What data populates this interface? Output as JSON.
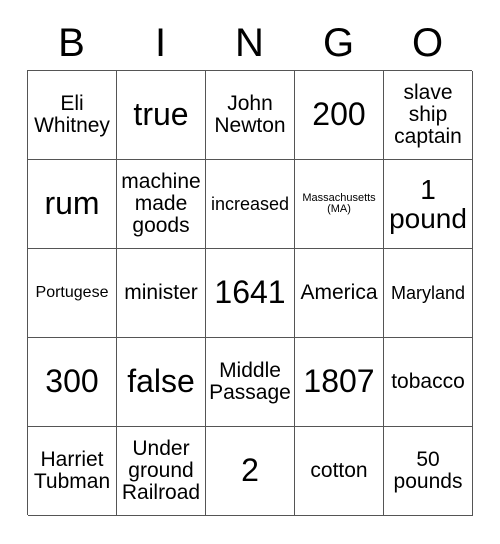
{
  "card": {
    "headers": [
      "B",
      "I",
      "N",
      "G",
      "O"
    ],
    "columns": 5,
    "rows": 5,
    "border_color": "#555555",
    "text_color": "#000000",
    "background_color": "#ffffff",
    "cells": [
      {
        "text": "Eli\nWhitney",
        "size": "md"
      },
      {
        "text": "true",
        "size": "xl"
      },
      {
        "text": "John\nNewton",
        "size": "md"
      },
      {
        "text": "200",
        "size": "xl"
      },
      {
        "text": "slave\nship\ncaptain",
        "size": "md"
      },
      {
        "text": "rum",
        "size": "xl"
      },
      {
        "text": "machine\nmade\ngoods",
        "size": "md"
      },
      {
        "text": "increased",
        "size": "sm"
      },
      {
        "text": "Massachusetts\n(MA)",
        "size": "xxs"
      },
      {
        "text": "1\npound",
        "size": "lg"
      },
      {
        "text": "Portugese",
        "size": "xs"
      },
      {
        "text": "minister",
        "size": "md"
      },
      {
        "text": "1641",
        "size": "xl"
      },
      {
        "text": "America",
        "size": "md"
      },
      {
        "text": "Maryland",
        "size": "sm"
      },
      {
        "text": "300",
        "size": "xl"
      },
      {
        "text": "false",
        "size": "xl"
      },
      {
        "text": "Middle\nPassage",
        "size": "md"
      },
      {
        "text": "1807",
        "size": "xl"
      },
      {
        "text": "tobacco",
        "size": "md"
      },
      {
        "text": "Harriet\nTubman",
        "size": "md"
      },
      {
        "text": "Under\nground\nRailroad",
        "size": "md"
      },
      {
        "text": "2",
        "size": "xl"
      },
      {
        "text": "cotton",
        "size": "md"
      },
      {
        "text": "50\npounds",
        "size": "md"
      }
    ]
  }
}
